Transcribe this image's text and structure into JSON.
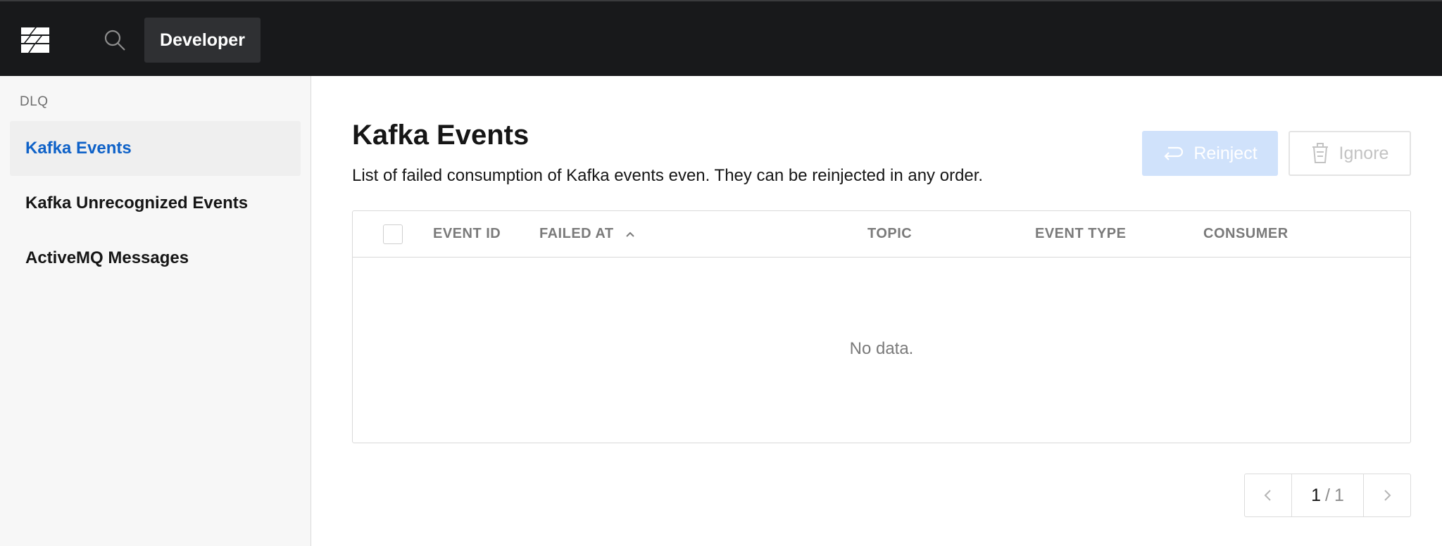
{
  "topbar": {
    "logo_icon": "brand-logo-icon",
    "search_icon": "search-icon",
    "environment_button": "Developer"
  },
  "sidebar": {
    "section_label": "DLQ",
    "items": [
      {
        "label": "Kafka Events",
        "active": true
      },
      {
        "label": "Kafka Unrecognized Events",
        "active": false
      },
      {
        "label": "ActiveMQ Messages",
        "active": false
      }
    ]
  },
  "main": {
    "title": "Kafka Events",
    "description": "List of failed consumption of Kafka events even. They can be reinjected in any order.",
    "actions": {
      "reinject_label": "Reinject",
      "reinject_icon": "return-arrow-icon",
      "ignore_label": "Ignore",
      "ignore_icon": "trash-icon"
    },
    "table": {
      "columns": [
        "EVENT ID",
        "FAILED AT",
        "TOPIC",
        "EVENT TYPE",
        "CONSUMER"
      ],
      "sorted_column": "FAILED AT",
      "sort_direction": "ascending",
      "empty_message": "No data."
    },
    "pagination": {
      "current": "1",
      "separator": "/",
      "total": "1"
    }
  },
  "colors": {
    "topbar_bg": "#18191b",
    "accent": "#0f62c8",
    "disabled_primary": "#d0e2fb"
  }
}
